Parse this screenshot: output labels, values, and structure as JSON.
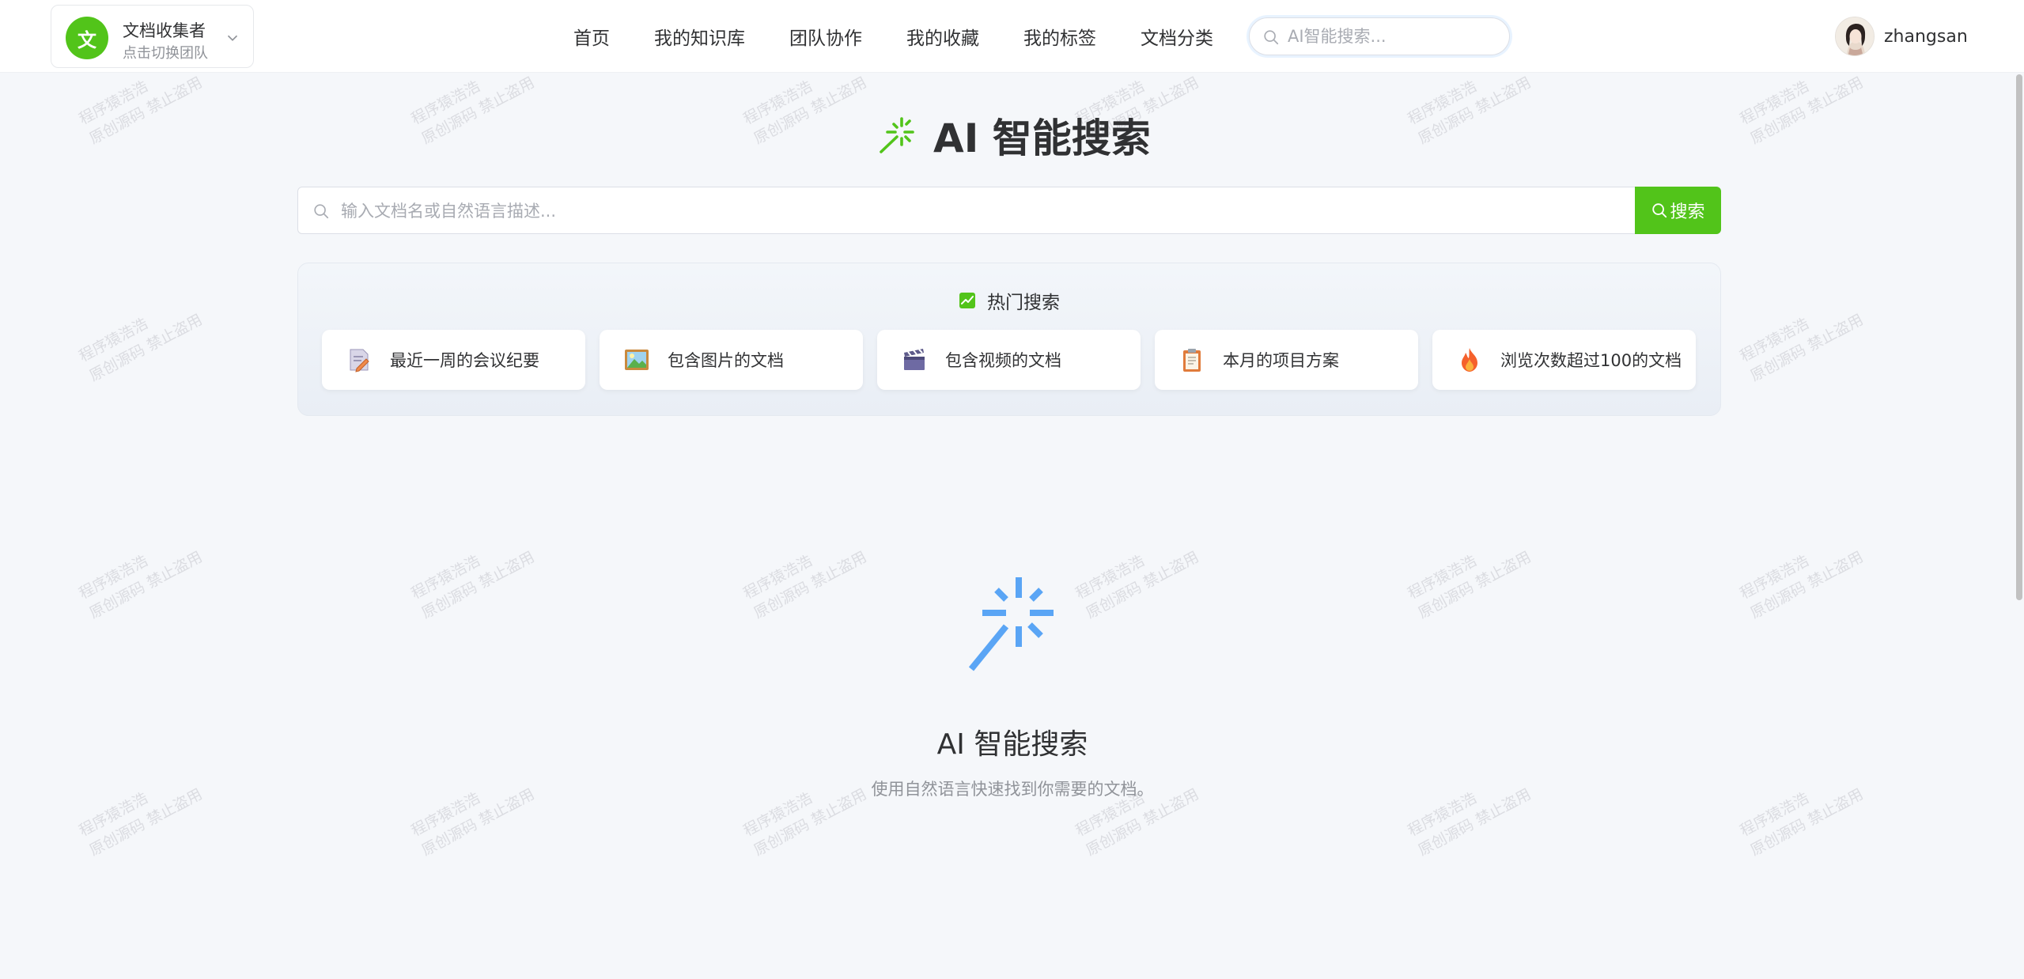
{
  "team": {
    "avatar_text": "文",
    "name": "文档收集者",
    "subtitle": "点击切换团队"
  },
  "nav": {
    "items": [
      {
        "label": "首页"
      },
      {
        "label": "我的知识库"
      },
      {
        "label": "团队协作"
      },
      {
        "label": "我的收藏"
      },
      {
        "label": "我的标签"
      },
      {
        "label": "文档分类"
      }
    ]
  },
  "top_search": {
    "placeholder": "AI智能搜索..."
  },
  "user": {
    "name": "zhangsan"
  },
  "watermark": {
    "line1": "程序猿浩浩",
    "line2": "原创源码 禁止盗用"
  },
  "main": {
    "title": "AI 智能搜索",
    "search_placeholder": "输入文档名或自然语言描述...",
    "search_button": "搜索"
  },
  "hot": {
    "title": "热门搜索",
    "items": [
      {
        "label": "最近一周的会议纪要",
        "icon": "memo-pencil-icon"
      },
      {
        "label": "包含图片的文档",
        "icon": "picture-icon"
      },
      {
        "label": "包含视频的文档",
        "icon": "clapperboard-icon"
      },
      {
        "label": "本月的项目方案",
        "icon": "clipboard-icon"
      },
      {
        "label": "浏览次数超过100的文档",
        "icon": "fire-icon"
      }
    ]
  },
  "empty": {
    "title": "AI 智能搜索",
    "description": "使用自然语言快速找到你需要的文档。"
  },
  "colors": {
    "brand_green": "#52c41a",
    "spark_blue": "#5aa5f5",
    "background": "#f5f7fa"
  }
}
